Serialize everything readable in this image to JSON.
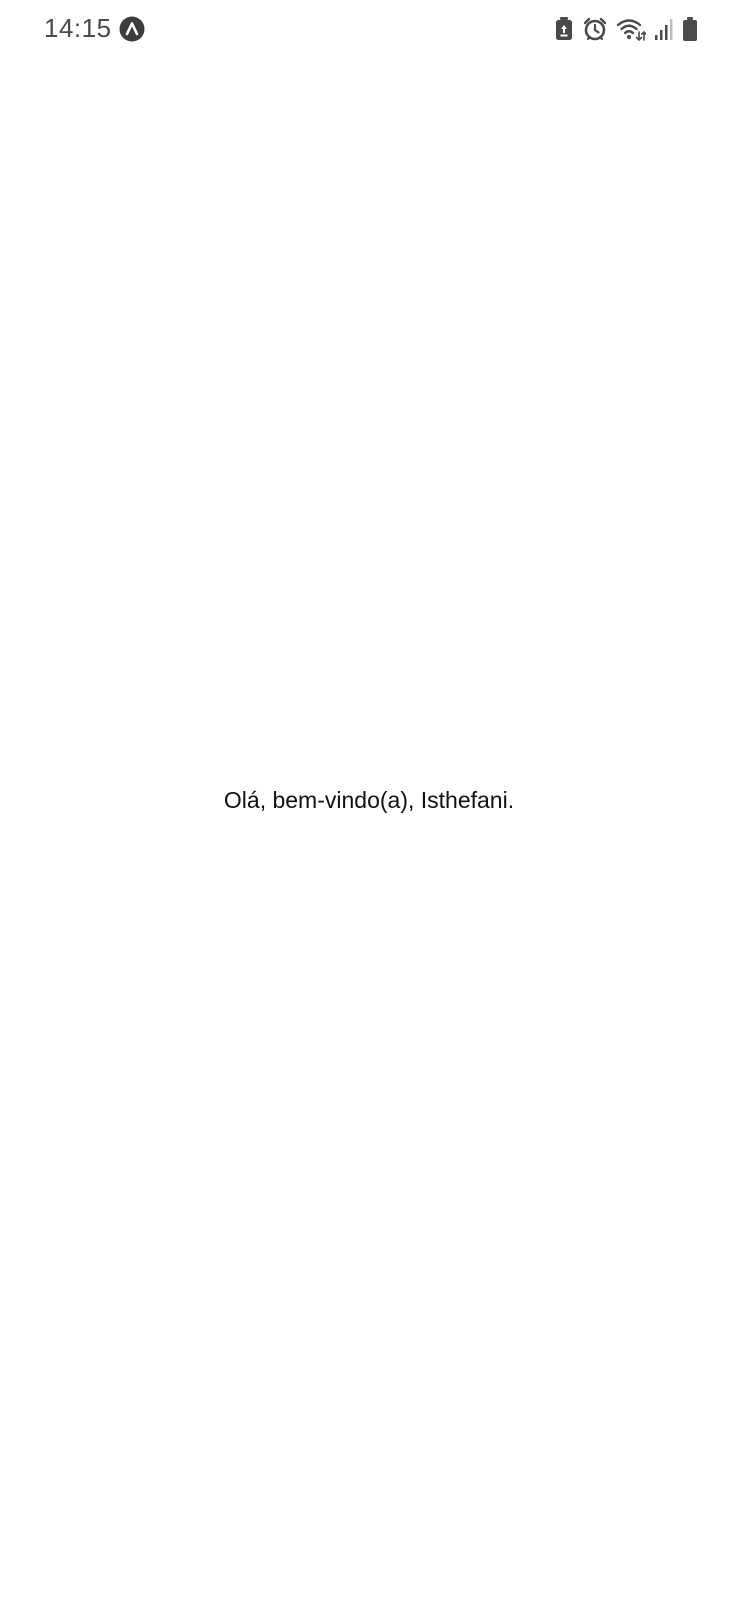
{
  "status_bar": {
    "time": "14:15",
    "notification_icon": "app-notification-icon",
    "icons": [
      "battery-saver-icon",
      "alarm-icon",
      "wifi-icon",
      "signal-icon",
      "battery-icon"
    ],
    "icon_color": "#4a4a4a"
  },
  "main": {
    "welcome": "Olá, bem-vindo(a), Isthefani."
  },
  "colors": {
    "background": "#ffffff",
    "text": "#111111"
  }
}
